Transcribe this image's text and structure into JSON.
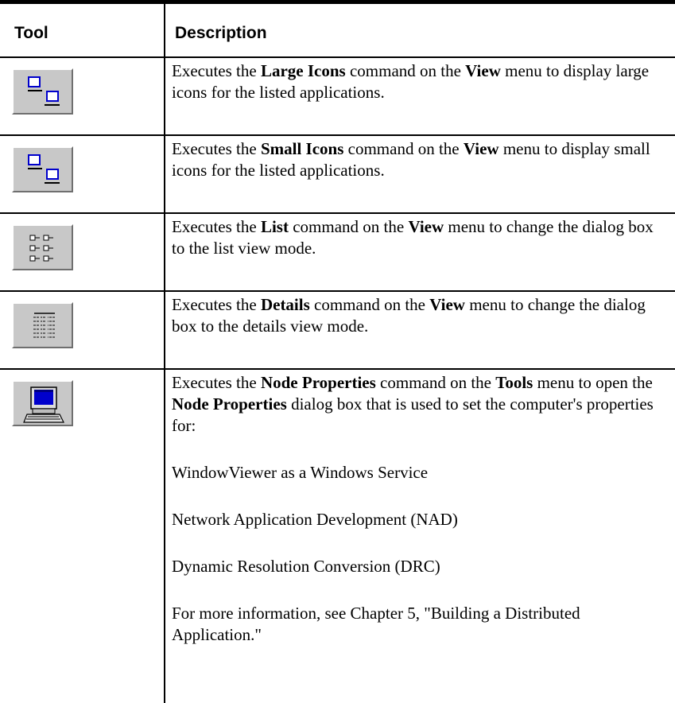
{
  "table": {
    "headers": {
      "tool": "Tool",
      "description": "Description"
    },
    "rows": [
      {
        "icon": "large-icons-icon",
        "parts": [
          "Executes the ",
          "Large Icons",
          " command on the ",
          "View",
          " menu to display large icons for the listed applications."
        ]
      },
      {
        "icon": "small-icons-icon",
        "parts": [
          "Executes the ",
          "Small Icons",
          " command on the ",
          "View",
          " menu to display small icons for the listed applications."
        ]
      },
      {
        "icon": "list-view-icon",
        "parts": [
          "Executes the ",
          "List",
          " command on the ",
          "View",
          " menu to change the dialog box to the list view mode."
        ]
      },
      {
        "icon": "details-view-icon",
        "parts": [
          "Executes the ",
          "Details",
          " command on the ",
          "View",
          " menu to change the dialog box to the details view mode."
        ]
      },
      {
        "icon": "node-properties-icon",
        "parts": [
          "Executes the ",
          "Node Properties",
          " command on the ",
          "Tools",
          " menu to open the ",
          "Node Properties",
          " dialog box that is used to set the computer's properties for:"
        ],
        "items": [
          "WindowViewer as a Windows Service",
          "Network Application Development (NAD)",
          "Dynamic Resolution Conversion (DRC)",
          "For more information, see Chapter 5, \"Building a Distributed Application.\""
        ]
      }
    ]
  }
}
